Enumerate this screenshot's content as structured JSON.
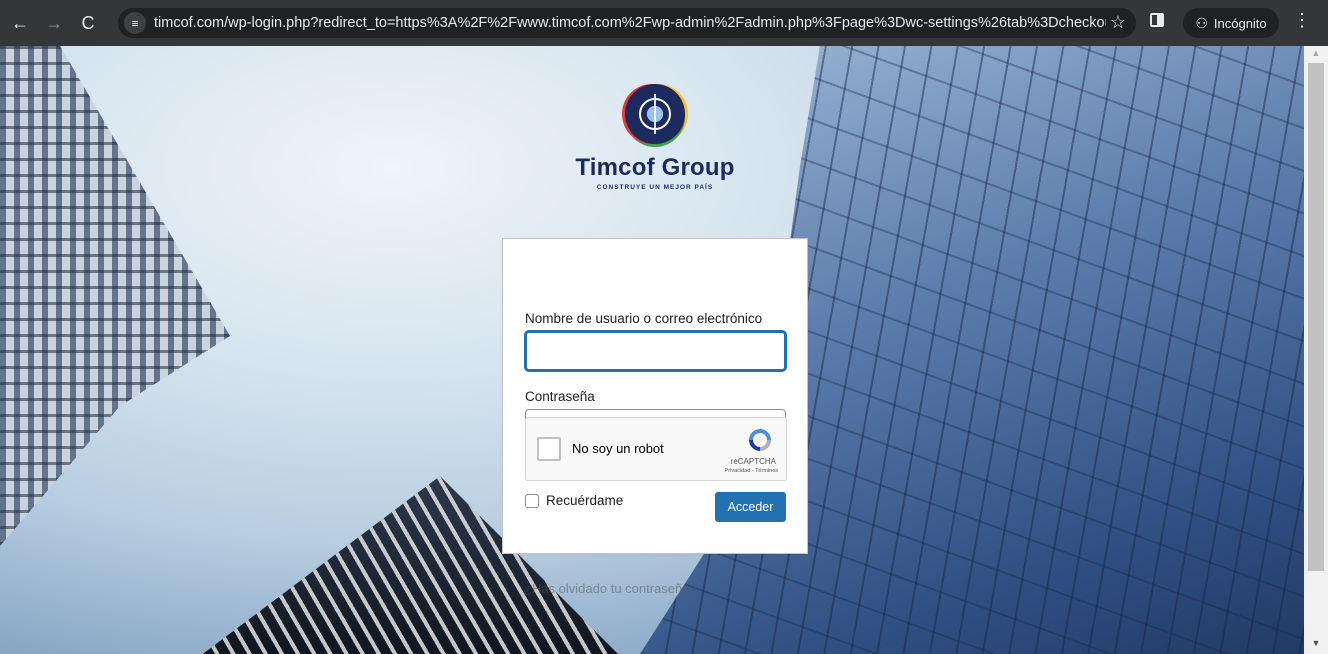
{
  "browser": {
    "back_icon": "←",
    "forward_icon": "→",
    "reload_icon": "C",
    "site_info_icon": "≡",
    "url": "timcof.com/wp-login.php?redirect_to=https%3A%2F%2Fwww.timcof.com%2Fwp-admin%2Fadmin.php%3Fpage%3Dwc-settings%26tab%3Dcheckout%26sec...",
    "star_icon": "☆",
    "incognito_label": "Incógnito",
    "incognito_icon": "⚇",
    "menu_icon": "⋮"
  },
  "logo": {
    "name": "Timcof Group",
    "tagline": "CONSTRUYE UN MEJOR PAÍS"
  },
  "login": {
    "username_label": "Nombre de usuario o correo electrónico",
    "username_value": "",
    "password_label": "Contraseña",
    "password_value": "",
    "eye_icon": "👁",
    "captcha": {
      "label": "No soy un robot",
      "brand": "reCAPTCHA",
      "links": "Privacidad - Términos"
    },
    "remember_label": "Recuérdame",
    "submit_label": "Acceder"
  },
  "lost_password": "¿Has olvidado tu contraseña?",
  "scrollbar": {
    "up_icon": "▲",
    "down_icon": "▼"
  },
  "colors": {
    "accent": "#2271b1",
    "chrome_bg": "#35363a",
    "logo_navy": "#1c2a5e"
  }
}
